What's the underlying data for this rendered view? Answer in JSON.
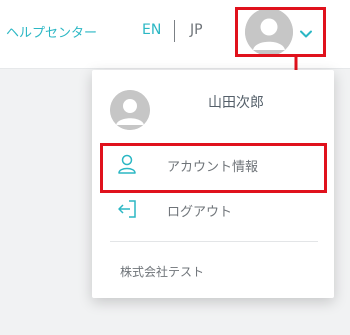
{
  "header": {
    "help_label": "ヘルプセンター",
    "lang_en": "EN",
    "lang_jp": "JP"
  },
  "dropdown": {
    "user_name": "山田次郎",
    "account_label": "アカウント情報",
    "logout_label": "ログアウト",
    "company_name": "株式会社テスト"
  },
  "icons": {
    "avatar": "user-avatar-icon",
    "chevron": "chevron-down-icon",
    "account": "user-outline-icon",
    "logout": "logout-icon"
  },
  "colors": {
    "accent": "#2bb7c4",
    "highlight": "#e0111c",
    "text_muted": "#6f7479",
    "avatar_gray": "#c6c6c6"
  }
}
